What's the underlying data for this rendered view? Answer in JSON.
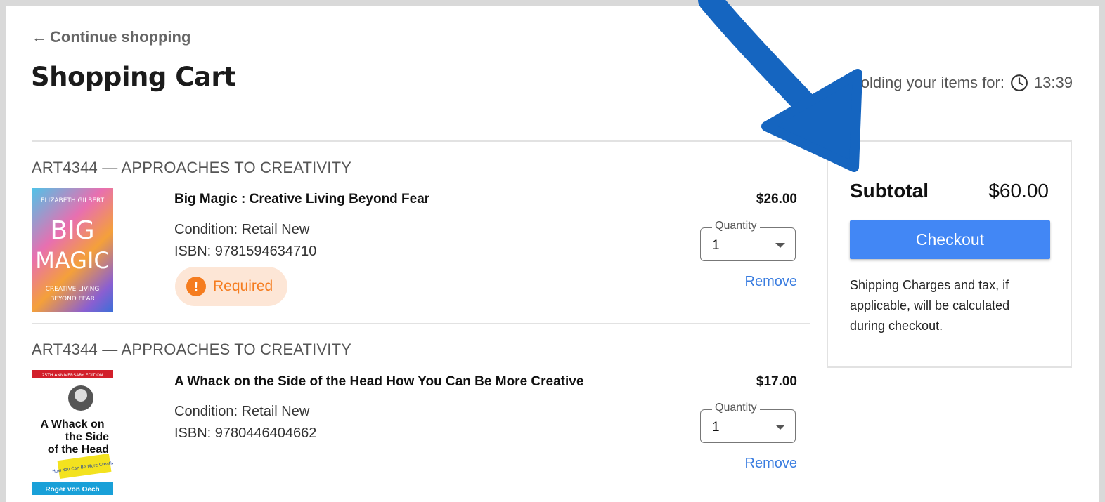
{
  "nav": {
    "continue_arrow": "←",
    "continue_label": "Continue shopping"
  },
  "page": {
    "title": "Shopping Cart"
  },
  "timer": {
    "label": "Holding your items for:",
    "icon": "clock-icon",
    "value": "13:39"
  },
  "items": [
    {
      "course": "ART4344 — APPROACHES TO CREATIVITY",
      "title": "Big Magic : Creative Living Beyond Fear",
      "condition": "Condition: Retail New",
      "isbn": "ISBN: 9781594634710",
      "price": "$26.00",
      "quantity_label": "Quantity",
      "quantity": "1",
      "remove": "Remove",
      "required_badge": "!",
      "required_label": "Required",
      "cover": {
        "author": "ELIZABETH GILBERT",
        "line1": "BIG",
        "line2": "MAGIC",
        "sub1": "CREATIVE LIVING",
        "sub2": "BEYOND FEAR"
      }
    },
    {
      "course": "ART4344 — APPROACHES TO CREATIVITY",
      "title": "A Whack on the Side of the Head How You Can Be More Creative",
      "condition": "Condition: Retail New",
      "isbn": "ISBN: 9780446404662",
      "price": "$17.00",
      "quantity_label": "Quantity",
      "quantity": "1",
      "remove": "Remove",
      "cover": {
        "banner": "25TH ANNIVERSARY EDITION",
        "t1": "A Whack on",
        "t2": "the Side",
        "t3": "of the Head",
        "sticker": "How You Can Be More Creative",
        "author": "Roger von Oech"
      }
    }
  ],
  "summary": {
    "subtotal_label": "Subtotal",
    "subtotal_value": "$60.00",
    "checkout_label": "Checkout",
    "note": "Shipping Charges and tax, if applicable, will be calculated during checkout."
  },
  "colors": {
    "accent": "#4287f5",
    "link": "#3a7de0",
    "required": "#f57c1f",
    "annotation_arrow": "#1565c0"
  }
}
